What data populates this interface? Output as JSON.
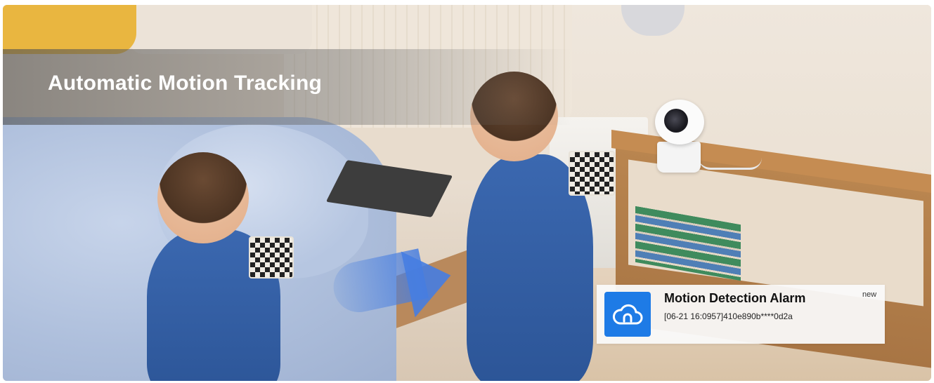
{
  "banner": {
    "title": "Automatic Motion Tracking"
  },
  "notification": {
    "title": "Motion Detection Alarm",
    "message": "[06-21 16:0957]410e890b****0d2a",
    "badge": "new",
    "icon": "cloud-icon",
    "icon_color": "#1e7be6"
  },
  "scene": {
    "arrow_color": "#467de1"
  }
}
